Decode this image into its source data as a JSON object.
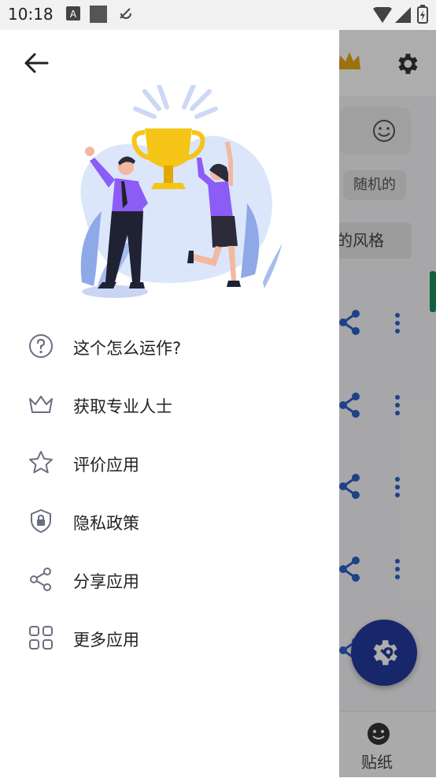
{
  "status_bar": {
    "time": "10:18"
  },
  "drawer": {
    "menu": [
      {
        "key": "how",
        "label": "这个怎么运作?",
        "icon": "help-circle-icon"
      },
      {
        "key": "pro",
        "label": "获取专业人士",
        "icon": "crown-icon"
      },
      {
        "key": "rate",
        "label": "评价应用",
        "icon": "star-icon"
      },
      {
        "key": "privacy",
        "label": "隐私政策",
        "icon": "shield-lock-icon"
      },
      {
        "key": "share",
        "label": "分享应用",
        "icon": "share-icon"
      },
      {
        "key": "more",
        "label": "更多应用",
        "icon": "grid-icon"
      }
    ]
  },
  "background": {
    "chip_random": "随机的",
    "style_label": "的风格",
    "bottom_nav_label": "贴纸"
  },
  "colors": {
    "accent_blue": "#243a9e",
    "icon_gray": "#6b6e80",
    "purple": "#8b5cf6"
  }
}
